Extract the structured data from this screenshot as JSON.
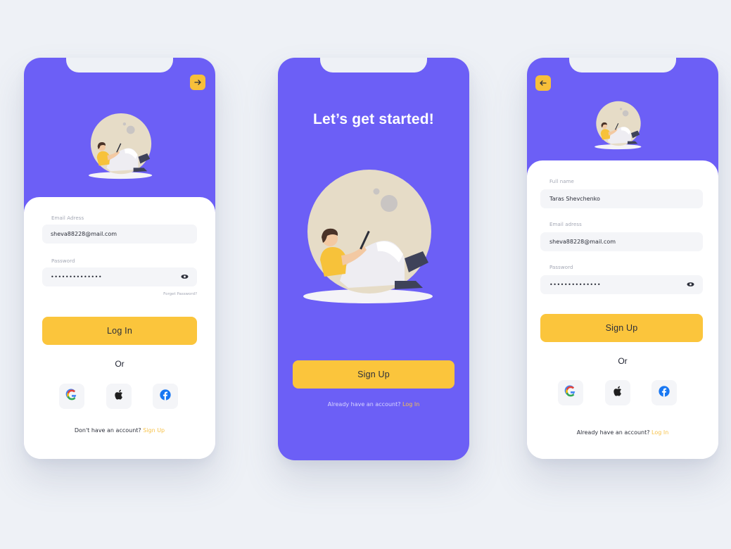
{
  "login": {
    "email_label": "Email Adress",
    "email_value": "sheva88228@mail.com",
    "password_label": "Password",
    "password_value": "••••••••••••••",
    "forgot_label": "Forget Password?",
    "login_button": "Log In",
    "or_label": "Or",
    "footer_text": "Don't have an account?",
    "footer_link": "Sign Up"
  },
  "welcome": {
    "headline": "Let’s get started!",
    "signup_button": "Sign Up",
    "footer_text": "Already have an account?",
    "footer_link": "Log In"
  },
  "signup": {
    "fullname_label": "Full name",
    "fullname_value": "Taras Shevchenko",
    "email_label": "Email adress",
    "email_value": "sheva88228@mail.com",
    "password_label": "Password",
    "password_value": "••••••••••••••",
    "signup_button": "Sign Up",
    "or_label": "Or",
    "footer_text": "Already have an account?",
    "footer_link": "Log In"
  },
  "icons": {
    "forward": "arrow-right-icon",
    "back": "arrow-left-icon",
    "eye": "eye-icon",
    "google": "google-icon",
    "apple": "apple-icon",
    "facebook": "facebook-icon"
  },
  "colors": {
    "primary": "#6c5ff6",
    "accent": "#fbc53c",
    "background": "#eef1f6",
    "field": "#f4f5f8"
  }
}
